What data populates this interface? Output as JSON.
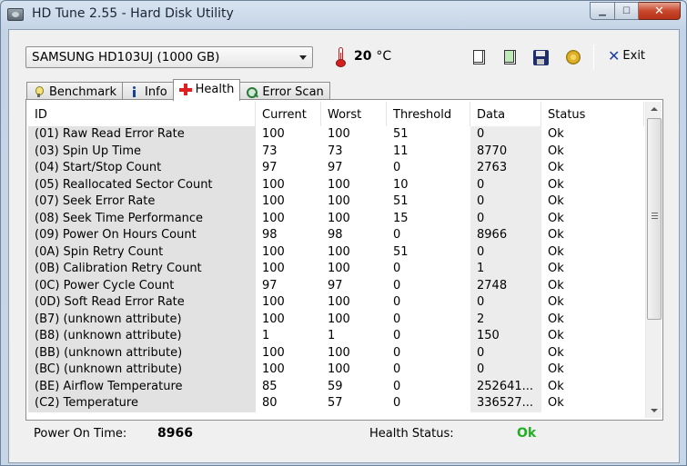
{
  "window": {
    "title": "HD Tune 2.55 - Hard Disk Utility",
    "controls": {
      "minimize": "▁",
      "maximize": "☐",
      "close": "✕"
    }
  },
  "toolbar": {
    "drive": "SAMSUNG HD103UJ (1000 GB)",
    "temperature_value": "20",
    "temperature_unit": "°C",
    "exit_label": "Exit",
    "icons": [
      "copy-text-icon",
      "copy-screenshot-icon",
      "save-icon",
      "options-icon",
      "exit-icon"
    ]
  },
  "tabs": [
    {
      "label": "Benchmark",
      "icon": "benchmark-icon",
      "active": false
    },
    {
      "label": "Info",
      "icon": "info-icon",
      "active": false
    },
    {
      "label": "Health",
      "icon": "health-cross-icon",
      "active": true
    },
    {
      "label": "Error Scan",
      "icon": "error-scan-icon",
      "active": false
    }
  ],
  "table": {
    "columns": [
      "ID",
      "Current",
      "Worst",
      "Threshold",
      "Data",
      "Status"
    ],
    "rows": [
      [
        "(01) Raw Read Error Rate",
        "100",
        "100",
        "51",
        "0",
        "Ok"
      ],
      [
        "(03) Spin Up Time",
        "73",
        "73",
        "11",
        "8770",
        "Ok"
      ],
      [
        "(04) Start/Stop Count",
        "97",
        "97",
        "0",
        "2763",
        "Ok"
      ],
      [
        "(05) Reallocated Sector Count",
        "100",
        "100",
        "10",
        "0",
        "Ok"
      ],
      [
        "(07) Seek Error Rate",
        "100",
        "100",
        "51",
        "0",
        "Ok"
      ],
      [
        "(08) Seek Time Performance",
        "100",
        "100",
        "15",
        "0",
        "Ok"
      ],
      [
        "(09) Power On Hours Count",
        "98",
        "98",
        "0",
        "8966",
        "Ok"
      ],
      [
        "(0A) Spin Retry Count",
        "100",
        "100",
        "51",
        "0",
        "Ok"
      ],
      [
        "(0B) Calibration Retry Count",
        "100",
        "100",
        "0",
        "1",
        "Ok"
      ],
      [
        "(0C) Power Cycle Count",
        "97",
        "97",
        "0",
        "2748",
        "Ok"
      ],
      [
        "(0D) Soft Read Error Rate",
        "100",
        "100",
        "0",
        "0",
        "Ok"
      ],
      [
        "(B7) (unknown attribute)",
        "100",
        "100",
        "0",
        "2",
        "Ok"
      ],
      [
        "(B8) (unknown attribute)",
        "1",
        "1",
        "0",
        "150",
        "Ok"
      ],
      [
        "(BB) (unknown attribute)",
        "100",
        "100",
        "0",
        "0",
        "Ok"
      ],
      [
        "(BC) (unknown attribute)",
        "100",
        "100",
        "0",
        "0",
        "Ok"
      ],
      [
        "(BE) Airflow Temperature",
        "85",
        "59",
        "0",
        "252641...",
        "Ok"
      ],
      [
        "(C2) Temperature",
        "80",
        "57",
        "0",
        "336527...",
        "Ok"
      ]
    ]
  },
  "footer": {
    "power_on_label": "Power On Time:",
    "power_on_value": "8966",
    "health_label": "Health Status:",
    "health_value": "Ok",
    "health_color": "#22b022"
  }
}
